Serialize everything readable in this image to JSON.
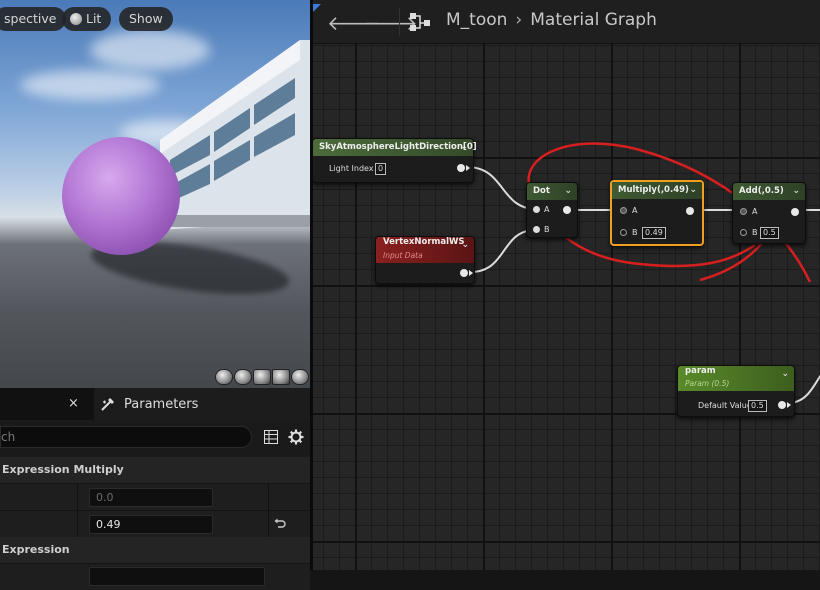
{
  "viewport": {
    "buttons": [
      {
        "label": "spective"
      },
      {
        "label": "Lit"
      },
      {
        "label": "Show"
      }
    ],
    "preview_shapes": [
      "sphere",
      "cube",
      "plane",
      "cylinder",
      "custom"
    ]
  },
  "details": {
    "tab_close": "×",
    "parameters_tab": "Parameters",
    "search_placeholder": "ch",
    "section1_title": "Expression Multiply",
    "row1_value": "0.0",
    "row2_value": "0.49",
    "section2_title": "Expression"
  },
  "graph": {
    "breadcrumb_asset": "M_toon",
    "breadcrumb_graph": "Material Graph",
    "nodes": {
      "sky": {
        "title": "SkyAtmosphereLightDirection[0]",
        "pin_label": "Light Index",
        "pin_value": "0"
      },
      "vertex": {
        "title": "VertexNormalWS",
        "subtitle": "Input Data"
      },
      "dot": {
        "title": "Dot",
        "a": "A",
        "b": "B"
      },
      "multiply": {
        "title": "Multiply(,0.49)",
        "a": "A",
        "b": "B",
        "b_value": "0.49"
      },
      "add": {
        "title": "Add(,0.5)",
        "a": "A",
        "b": "B",
        "b_value": "0.5"
      },
      "param": {
        "title": "param",
        "subtitle": "Param (0.5)",
        "pin_label": "Default Value",
        "pin_value": "0.5"
      }
    }
  },
  "colors": {
    "selected_outline": "#f0a020",
    "annotation": "#d81f1f",
    "sphere": "#b57ad6",
    "node_constant_title": "#4a6a38",
    "node_math_title": "#3a5230",
    "node_input_title": "#7a1e1e",
    "param_title": "#4f7a26"
  }
}
